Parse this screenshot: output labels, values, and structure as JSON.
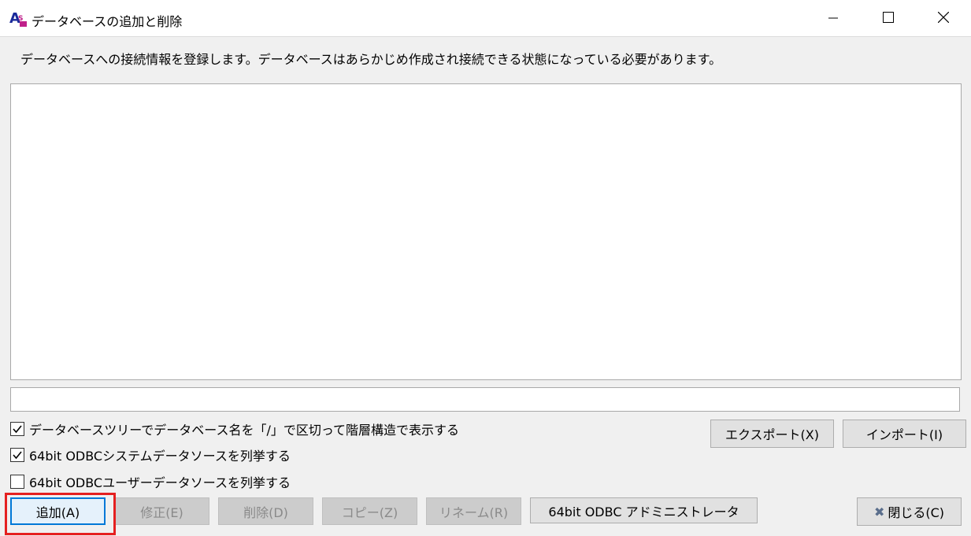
{
  "window": {
    "title": "データベースの追加と削除",
    "controls": [
      "minimize-icon",
      "maximize-icon",
      "close-icon"
    ]
  },
  "description": "データベースへの接続情報を登録します。データベースはあらかじめ作成され接続できる状態になっている必要があります。",
  "list": {
    "items": []
  },
  "name_field": {
    "value": ""
  },
  "options": [
    {
      "label": "データベースツリーでデータベース名を「/」で区切って階層構造で表示する",
      "checked": true
    },
    {
      "label": "64bit ODBCシステムデータソースを列挙する",
      "checked": true
    },
    {
      "label": "64bit ODBCユーザーデータソースを列挙する",
      "checked": false
    }
  ],
  "side_buttons": {
    "export": "エクスポート(X)",
    "import": "インポート(I)"
  },
  "buttons": {
    "add": "追加(A)",
    "edit": "修正(E)",
    "delete": "削除(D)",
    "copy": "コピー(Z)",
    "rename": "リネーム(R)",
    "odbc_admin": "64bit ODBC アドミニストレータ",
    "close": "閉じる(C)"
  },
  "colors": {
    "focus": "#0078d7",
    "highlight": "#e52020"
  }
}
